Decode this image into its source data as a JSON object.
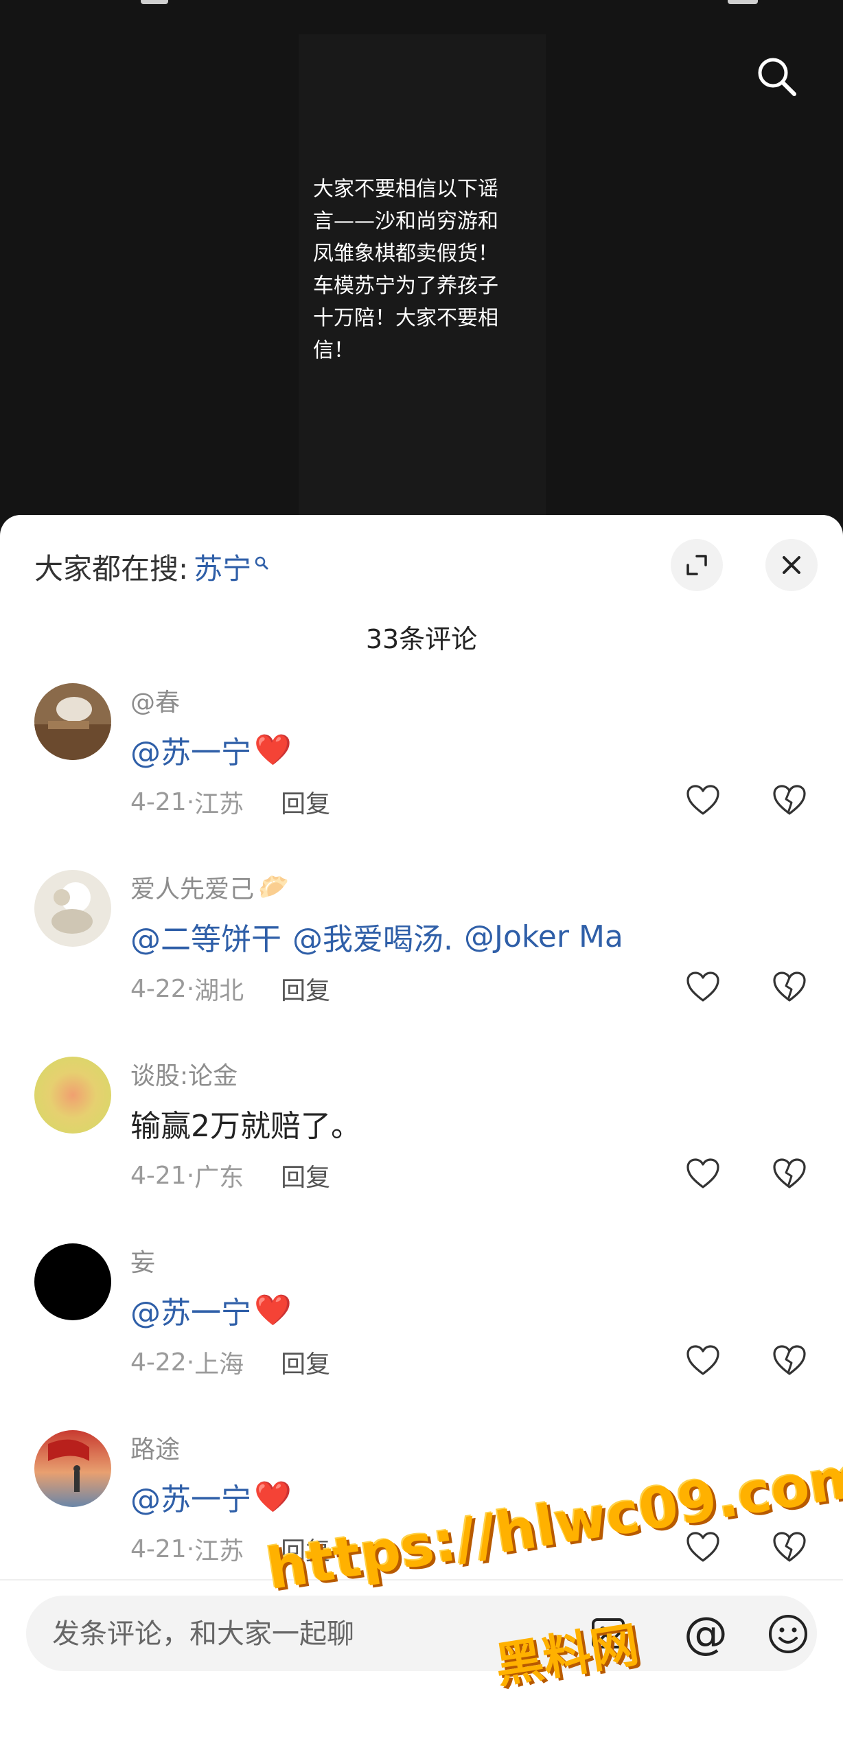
{
  "video": {
    "caption": "大家不要相信以下谣\n言——沙和尚穷游和\n凤雏象棋都卖假货！\n车模苏宁为了养孩子\n十万陪！大家不要相\n信！"
  },
  "sheet": {
    "trending_prefix": "大家都在搜:",
    "trending_keyword": "苏宁",
    "comment_count": "33条评论"
  },
  "comments": [
    {
      "username": "@春",
      "mentions": [
        "@苏一宁"
      ],
      "text": "",
      "emoji": "❤️",
      "date": "4-21",
      "location": "江苏",
      "reply": "回复"
    },
    {
      "username": "爱人先爱己",
      "username_emoji": "🥟",
      "mentions": [
        "@二等饼干",
        "@我爱喝汤.",
        "@Joker Ma"
      ],
      "text": "",
      "date": "4-22",
      "location": "湖北",
      "reply": "回复"
    },
    {
      "username": "谈股:论金",
      "mentions": [],
      "text": "输赢2万就赔了。",
      "date": "4-21",
      "location": "广东",
      "reply": "回复"
    },
    {
      "username": "妄",
      "mentions": [
        "@苏一宁"
      ],
      "text": "",
      "emoji": "❤️",
      "date": "4-22",
      "location": "上海",
      "reply": "回复"
    },
    {
      "username": "路途",
      "mentions": [
        "@苏一宁"
      ],
      "text": "",
      "emoji": "❤️",
      "date": "4-21",
      "location": "江苏",
      "reply": "回复"
    }
  ],
  "input": {
    "placeholder": "发条评论，和大家一起聊",
    "at_label": "@"
  },
  "watermark": {
    "line1": "https://hlwc09.com",
    "line2": "黑料网"
  },
  "colors": {
    "mention": "#2f5fa8",
    "watermark": "#ffb100",
    "video_bg": "#141414"
  }
}
